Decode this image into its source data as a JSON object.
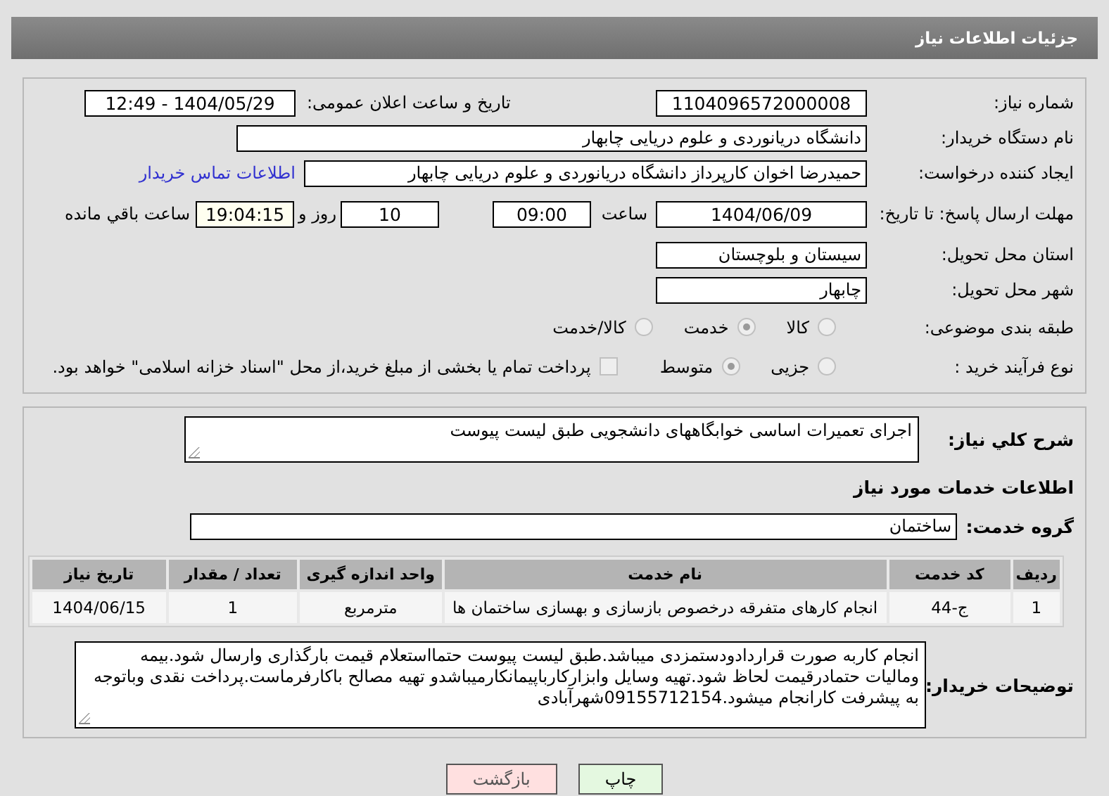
{
  "header": {
    "title": "جزئیات اطلاعات نیاز"
  },
  "details": {
    "need_number": {
      "label": "شماره نیاز:",
      "value": "1104096572000008"
    },
    "announce": {
      "label": "تاریخ و ساعت اعلان عمومی:",
      "value": "1404/05/29 - 12:49"
    },
    "buyer_org": {
      "label": "نام دستگاه خریدار:",
      "value": "دانشگاه دریانوردی و علوم دریایی چابهار"
    },
    "creator": {
      "label": "ایجاد کننده درخواست:",
      "value": "حمیدرضا اخوان کارپرداز دانشگاه دریانوردی و علوم دریایی چابهار",
      "link": "اطلاعات تماس خریدار"
    },
    "deadline": {
      "label": "مهلت ارسال پاسخ: تا تاریخ:",
      "date": "1404/06/09",
      "time_label": "ساعت",
      "time": "09:00",
      "days": "10",
      "days_label": "روز و",
      "remaining": "19:04:15",
      "remaining_label": "ساعت باقي مانده"
    },
    "province": {
      "label": "استان محل تحویل:",
      "value": "سیستان و بلوچستان"
    },
    "city": {
      "label": "شهر محل تحویل:",
      "value": "چابهار"
    },
    "category": {
      "label": "طبقه بندی موضوعی:",
      "options": [
        {
          "label": "کالا",
          "selected": false
        },
        {
          "label": "خدمت",
          "selected": true
        },
        {
          "label": "کالا/خدمت",
          "selected": false
        }
      ]
    },
    "process": {
      "label": "نوع فرآیند خرید :",
      "options": [
        {
          "label": "جزیی",
          "selected": false
        },
        {
          "label": "متوسط",
          "selected": true
        }
      ],
      "payment": {
        "label": "پرداخت تمام یا بخشی از مبلغ خرید،از محل \"اسناد خزانه اسلامی\" خواهد بود.",
        "checked": false
      }
    }
  },
  "summary": {
    "label": "شرح کلي نياز:",
    "value": "اجرای تعمیرات اساسی خوابگاههای دانشجویی طبق لیست پیوست"
  },
  "services": {
    "title": "اطلاعات خدمات مورد نیاز",
    "group_label": "گروه خدمت:",
    "group": "ساختمان",
    "columns": [
      "ردیف",
      "کد خدمت",
      "نام خدمت",
      "واحد اندازه گیری",
      "تعداد / مقدار",
      "تاریخ نیاز"
    ],
    "rows": [
      [
        "1",
        "ج-44",
        "انجام کارهای متفرقه درخصوص بازسازی و بهسازی ساختمان ها",
        "مترمربع",
        "1",
        "1404/06/15"
      ]
    ]
  },
  "notes": {
    "label": "توضیحات خریدار:",
    "value": "انجام کاربه صورت قراردادودستمزدی میباشد.طبق لیست پیوست حتمااستعلام قیمت بارگذاری وارسال شود.بیمه ومالیات حتمادرقیمت لحاظ شود.تهیه وسایل وابزارکارباپیمانکارمیباشدو تهیه مصالح باکارفرماست.پرداخت نقدی وباتوجه به پیشرفت کارانجام میشود.09155712154شهرآبادی"
  },
  "buttons": [
    {
      "label": "چاپ",
      "kind": "print"
    },
    {
      "label": "بازگشت",
      "kind": "back"
    }
  ]
}
